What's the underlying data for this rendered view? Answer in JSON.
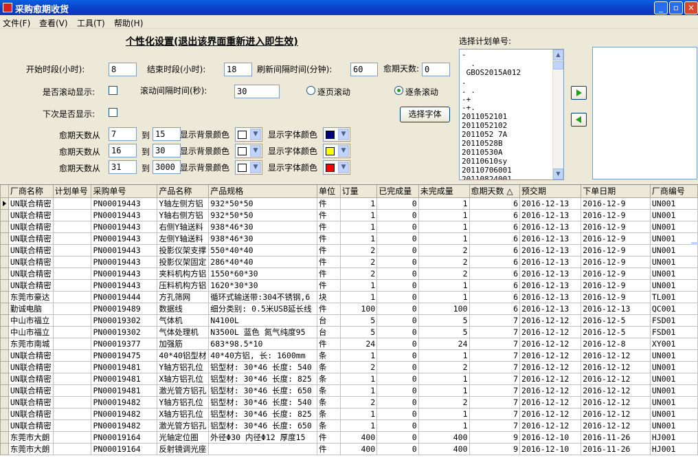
{
  "window": {
    "title": "采购愈期收货",
    "minimize": "_",
    "maximize": "▫",
    "close": "×"
  },
  "menu": [
    "文件(F)",
    "查看(V)",
    "工具(T)",
    "帮助(H)"
  ],
  "settings": {
    "heading": "个性化设置(退出该界面重新进入即生效)",
    "start_label": "开始时段(小时):",
    "start_value": "8",
    "end_label": "结束时段(小时):",
    "end_value": "18",
    "refresh_label": "刷新间隔时间(分钟):",
    "refresh_value": "60",
    "overdue_label": "愈期天数:",
    "overdue_value": "0",
    "scroll_label": "是否滚动显示:",
    "scroll_interval_label": "滚动间隔时间(秒):",
    "scroll_interval_value": "30",
    "page_scroll_label": "逐页滚动",
    "row_scroll_label": "逐条滚动",
    "next_show_label": "下次是否显示:",
    "font_button": "选择字体",
    "rules": [
      {
        "from_label": "愈期天数从",
        "from": "7",
        "to_label": "到",
        "to": "15",
        "bg_label": "显示背景颜色",
        "bg": "#ffffff",
        "fg_label": "显示字体颜色",
        "fg": "#000080"
      },
      {
        "from_label": "愈期天数从",
        "from": "16",
        "to_label": "到",
        "to": "30",
        "bg_label": "显示背景颜色",
        "bg": "#ffffff",
        "fg_label": "显示字体颜色",
        "fg": "#ffff00"
      },
      {
        "from_label": "愈期天数从",
        "from": "31",
        "to_label": "到",
        "to": "3000",
        "bg_label": "显示背景颜色",
        "bg": "#ffffff",
        "fg_label": "显示字体颜色",
        "fg": "#ff0000"
      }
    ]
  },
  "plan": {
    "label": "选择计划单号:",
    "items": [
      "-",
      "  .",
      " GBOS2015A012",
      ".",
      ". .",
      "-+",
      "-+.",
      "2011052101",
      "2011052102",
      "2011052 7A",
      "20110528B",
      "20110530A",
      "20110610sy",
      "20110706001",
      "20110824001"
    ]
  },
  "grid": {
    "columns": [
      "厂商名称",
      "计划单号",
      "采购单号",
      "产品名称",
      "产品规格",
      "单位",
      "订量",
      "已完成量",
      "未完成量",
      "愈期天数 △",
      "预交期",
      "下单日期",
      "厂商编号"
    ],
    "rows": [
      [
        "UN联合精密",
        "",
        "PN00019443",
        "Y轴左侧方铝",
        "932*50*50",
        "件",
        "1",
        "0",
        "1",
        "6",
        "2016-12-13",
        "2016-12-9",
        "UN001"
      ],
      [
        "UN联合精密",
        "",
        "PN00019443",
        "Y轴右侧方铝",
        "932*50*50",
        "件",
        "1",
        "0",
        "1",
        "6",
        "2016-12-13",
        "2016-12-9",
        "UN001"
      ],
      [
        "UN联合精密",
        "",
        "PN00019443",
        "右侧Y轴送料",
        "938*46*30",
        "件",
        "1",
        "0",
        "1",
        "6",
        "2016-12-13",
        "2016-12-9",
        "UN001"
      ],
      [
        "UN联合精密",
        "",
        "PN00019443",
        "左侧Y轴送料",
        "938*46*30",
        "件",
        "1",
        "0",
        "1",
        "6",
        "2016-12-13",
        "2016-12-9",
        "UN001"
      ],
      [
        "UN联合精密",
        "",
        "PN00019443",
        "投影仪架支撑",
        "550*40*40",
        "件",
        "2",
        "0",
        "2",
        "6",
        "2016-12-13",
        "2016-12-9",
        "UN001"
      ],
      [
        "UN联合精密",
        "",
        "PN00019443",
        "投影仪架固定",
        "286*40*40",
        "件",
        "2",
        "0",
        "2",
        "6",
        "2016-12-13",
        "2016-12-9",
        "UN001"
      ],
      [
        "UN联合精密",
        "",
        "PN00019443",
        "夹料机构方铝",
        "1550*60*30",
        "件",
        "2",
        "0",
        "2",
        "6",
        "2016-12-13",
        "2016-12-9",
        "UN001"
      ],
      [
        "UN联合精密",
        "",
        "PN00019443",
        "压料机构方铝",
        "1620*30*30",
        "件",
        "1",
        "0",
        "1",
        "6",
        "2016-12-13",
        "2016-12-9",
        "UN001"
      ],
      [
        "东莞市豪达",
        "",
        "PN00019444",
        "方孔筛网",
        "循环式输送带:304不锈钢,6",
        "块",
        "1",
        "0",
        "1",
        "6",
        "2016-12-13",
        "2016-12-9",
        "TL001"
      ],
      [
        "勤诚电脑",
        "",
        "PN00019489",
        "数据线",
        "细分类别: 0.5米USB延长线",
        "件",
        "100",
        "0",
        "100",
        "6",
        "2016-12-13",
        "2016-12-13",
        "QC001"
      ],
      [
        "中山市福立",
        "",
        "PN00019302",
        "气体机",
        "N4100L",
        "台",
        "5",
        "0",
        "5",
        "7",
        "2016-12-12",
        "2016-12-5",
        "FSD01"
      ],
      [
        "中山市福立",
        "",
        "PN00019302",
        "气体处理机",
        "N3500L  蓝色  氮气纯度95",
        "台",
        "5",
        "0",
        "5",
        "7",
        "2016-12-12",
        "2016-12-5",
        "FSD01"
      ],
      [
        "东莞市南城",
        "",
        "PN00019377",
        "加强筋",
        "683*98.5*10",
        "件",
        "24",
        "0",
        "24",
        "7",
        "2016-12-12",
        "2016-12-8",
        "XY001"
      ],
      [
        "UN联合精密",
        "",
        "PN00019475",
        "40*40铝型材",
        "40*40方铝, 长: 1600mm",
        "条",
        "1",
        "0",
        "1",
        "7",
        "2016-12-12",
        "2016-12-12",
        "UN001"
      ],
      [
        "UN联合精密",
        "",
        "PN00019481",
        "Y轴方铝孔位",
        "铝型材: 30*46  长度: 540",
        "条",
        "2",
        "0",
        "2",
        "7",
        "2016-12-12",
        "2016-12-12",
        "UN001"
      ],
      [
        "UN联合精密",
        "",
        "PN00019481",
        "X轴方铝孔位",
        "铝型材: 30*46  长度: 825",
        "条",
        "1",
        "0",
        "1",
        "7",
        "2016-12-12",
        "2016-12-12",
        "UN001"
      ],
      [
        "UN联合精密",
        "",
        "PN00019481",
        "激光管方铝孔",
        "铝型材: 30*46  长度: 650",
        "条",
        "1",
        "0",
        "1",
        "7",
        "2016-12-12",
        "2016-12-12",
        "UN001"
      ],
      [
        "UN联合精密",
        "",
        "PN00019482",
        "Y轴方铝孔位",
        "铝型材: 30*46  长度: 540",
        "条",
        "2",
        "0",
        "2",
        "7",
        "2016-12-12",
        "2016-12-12",
        "UN001"
      ],
      [
        "UN联合精密",
        "",
        "PN00019482",
        "X轴方铝孔位",
        "铝型材: 30*46  长度: 825",
        "条",
        "1",
        "0",
        "1",
        "7",
        "2016-12-12",
        "2016-12-12",
        "UN001"
      ],
      [
        "UN联合精密",
        "",
        "PN00019482",
        "激光管方铝孔",
        "铝型材: 30*46  长度: 650",
        "条",
        "1",
        "0",
        "1",
        "7",
        "2016-12-12",
        "2016-12-12",
        "UN001"
      ],
      [
        "东莞市大朗",
        "",
        "PN00019164",
        "光轴定位圈",
        "外径Φ30 内径Φ12 厚度15",
        "件",
        "400",
        "0",
        "400",
        "9",
        "2016-12-10",
        "2016-11-26",
        "HJ001"
      ],
      [
        "东莞市大朗",
        "",
        "PN00019164",
        "反射镜调光座",
        "",
        "件",
        "400",
        "0",
        "400",
        "9",
        "2016-12-10",
        "2016-11-26",
        "HJ001"
      ]
    ]
  }
}
